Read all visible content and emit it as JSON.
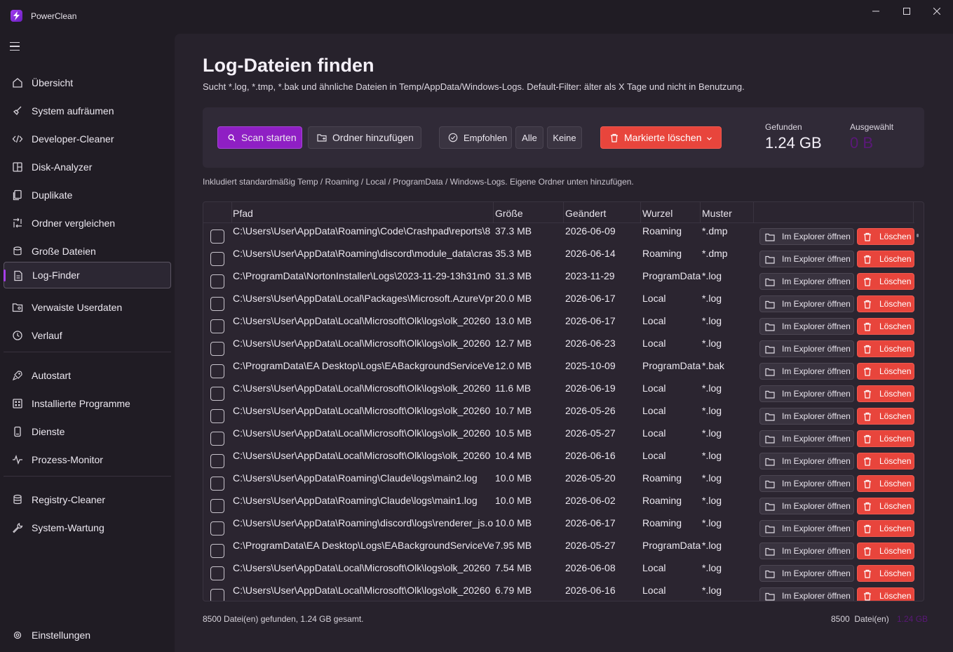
{
  "app": {
    "title": "PowerClean"
  },
  "colors": {
    "accent": "#8f1fc4",
    "danger": "#e8453c",
    "selected_value": "#5a1878"
  },
  "sidebar": {
    "items": [
      {
        "label": "Übersicht",
        "icon": "home-icon"
      },
      {
        "label": "System aufräumen",
        "icon": "broom-icon"
      },
      {
        "label": "Developer-Cleaner",
        "icon": "code-icon"
      },
      {
        "label": "Disk-Analyzer",
        "icon": "disk-icon"
      },
      {
        "label": "Duplikate",
        "icon": "copy-icon"
      },
      {
        "label": "Ordner vergleichen",
        "icon": "compare-icon"
      },
      {
        "label": "Große Dateien",
        "icon": "stack-icon"
      },
      {
        "label": "Log-Finder",
        "icon": "document-icon"
      },
      {
        "label": "Verwaiste Userdaten",
        "icon": "folder-user-icon"
      },
      {
        "label": "Verlauf",
        "icon": "history-icon"
      },
      {
        "label": "Autostart",
        "icon": "rocket-icon"
      },
      {
        "label": "Installierte Programme",
        "icon": "apps-icon"
      },
      {
        "label": "Dienste",
        "icon": "service-icon"
      },
      {
        "label": "Prozess-Monitor",
        "icon": "pulse-icon"
      },
      {
        "label": "Registry-Cleaner",
        "icon": "database-icon"
      },
      {
        "label": "System-Wartung",
        "icon": "wrench-icon"
      }
    ],
    "settings_label": "Einstellungen",
    "active": "Log-Finder"
  },
  "page": {
    "title": "Log-Dateien finden",
    "subtitle": "Sucht *.log, *.tmp, *.bak und ähnliche Dateien in Temp/AppData/Windows-Logs. Default-Filter: älter als X Tage und nicht in Benutzung.",
    "info": "Inkludiert standardmäßig Temp / Roaming / Local / ProgramData / Windows-Logs. Eigene Ordner unten hinzufügen."
  },
  "toolbar": {
    "scan_label": "Scan starten",
    "add_folder_label": "Ordner hinzufügen",
    "recommended_label": "Empfohlen",
    "all_label": "Alle",
    "none_label": "Keine",
    "delete_marked_label": "Markierte löschen",
    "found_label": "Gefunden",
    "found_value": "1.24 GB",
    "selected_label": "Ausgewählt",
    "selected_value": "0 B"
  },
  "table": {
    "columns": [
      "Pfad",
      "Größe",
      "Geändert",
      "Wurzel",
      "Muster"
    ],
    "open_label": "Im Explorer öffnen",
    "delete_label": "Löschen",
    "rows": [
      {
        "path": "C:\\Users\\User\\AppData\\Roaming\\Code\\Crashpad\\reports\\8",
        "size": "37.3 MB",
        "date": "2026-06-09",
        "root": "Roaming",
        "pattern": "*.dmp"
      },
      {
        "path": "C:\\Users\\User\\AppData\\Roaming\\discord\\module_data\\cras",
        "size": "35.3 MB",
        "date": "2026-06-14",
        "root": "Roaming",
        "pattern": "*.dmp"
      },
      {
        "path": "C:\\ProgramData\\NortonInstaller\\Logs\\2023-11-29-13h31m0",
        "size": "31.3 MB",
        "date": "2023-11-29",
        "root": "ProgramData",
        "pattern": "*.log"
      },
      {
        "path": "C:\\Users\\User\\AppData\\Local\\Packages\\Microsoft.AzureVpn",
        "size": "20.0 MB",
        "date": "2026-06-17",
        "root": "Local",
        "pattern": "*.log"
      },
      {
        "path": "C:\\Users\\User\\AppData\\Local\\Microsoft\\Olk\\logs\\olk_20260",
        "size": "13.0 MB",
        "date": "2026-06-17",
        "root": "Local",
        "pattern": "*.log"
      },
      {
        "path": "C:\\Users\\User\\AppData\\Local\\Microsoft\\Olk\\logs\\olk_20260",
        "size": "12.7 MB",
        "date": "2026-06-23",
        "root": "Local",
        "pattern": "*.log"
      },
      {
        "path": "C:\\ProgramData\\EA Desktop\\Logs\\EABackgroundServiceVer",
        "size": "12.0 MB",
        "date": "2025-10-09",
        "root": "ProgramData",
        "pattern": "*.bak"
      },
      {
        "path": "C:\\Users\\User\\AppData\\Local\\Microsoft\\Olk\\logs\\olk_20260",
        "size": "11.6 MB",
        "date": "2026-06-19",
        "root": "Local",
        "pattern": "*.log"
      },
      {
        "path": "C:\\Users\\User\\AppData\\Local\\Microsoft\\Olk\\logs\\olk_20260",
        "size": "10.7 MB",
        "date": "2026-05-26",
        "root": "Local",
        "pattern": "*.log"
      },
      {
        "path": "C:\\Users\\User\\AppData\\Local\\Microsoft\\Olk\\logs\\olk_20260",
        "size": "10.5 MB",
        "date": "2026-05-27",
        "root": "Local",
        "pattern": "*.log"
      },
      {
        "path": "C:\\Users\\User\\AppData\\Local\\Microsoft\\Olk\\logs\\olk_20260",
        "size": "10.4 MB",
        "date": "2026-06-16",
        "root": "Local",
        "pattern": "*.log"
      },
      {
        "path": "C:\\Users\\User\\AppData\\Roaming\\Claude\\logs\\main2.log",
        "size": "10.0 MB",
        "date": "2026-05-20",
        "root": "Roaming",
        "pattern": "*.log"
      },
      {
        "path": "C:\\Users\\User\\AppData\\Roaming\\Claude\\logs\\main1.log",
        "size": "10.0 MB",
        "date": "2026-06-02",
        "root": "Roaming",
        "pattern": "*.log"
      },
      {
        "path": "C:\\Users\\User\\AppData\\Roaming\\discord\\logs\\renderer_js.o",
        "size": "10.0 MB",
        "date": "2026-06-17",
        "root": "Roaming",
        "pattern": "*.log"
      },
      {
        "path": "C:\\ProgramData\\EA Desktop\\Logs\\EABackgroundServiceVer",
        "size": "7.95 MB",
        "date": "2026-05-27",
        "root": "ProgramData",
        "pattern": "*.log"
      },
      {
        "path": "C:\\Users\\User\\AppData\\Local\\Microsoft\\Olk\\logs\\olk_20260",
        "size": "7.54 MB",
        "date": "2026-06-08",
        "root": "Local",
        "pattern": "*.log"
      },
      {
        "path": "C:\\Users\\User\\AppData\\Local\\Microsoft\\Olk\\logs\\olk_20260",
        "size": "6.79 MB",
        "date": "2026-06-16",
        "root": "Local",
        "pattern": "*.log"
      }
    ]
  },
  "footer": {
    "summary": "8500 Datei(en) gefunden, 1.24 GB gesamt.",
    "count": "8500  Datei(en)",
    "size": "1.24 GB"
  }
}
